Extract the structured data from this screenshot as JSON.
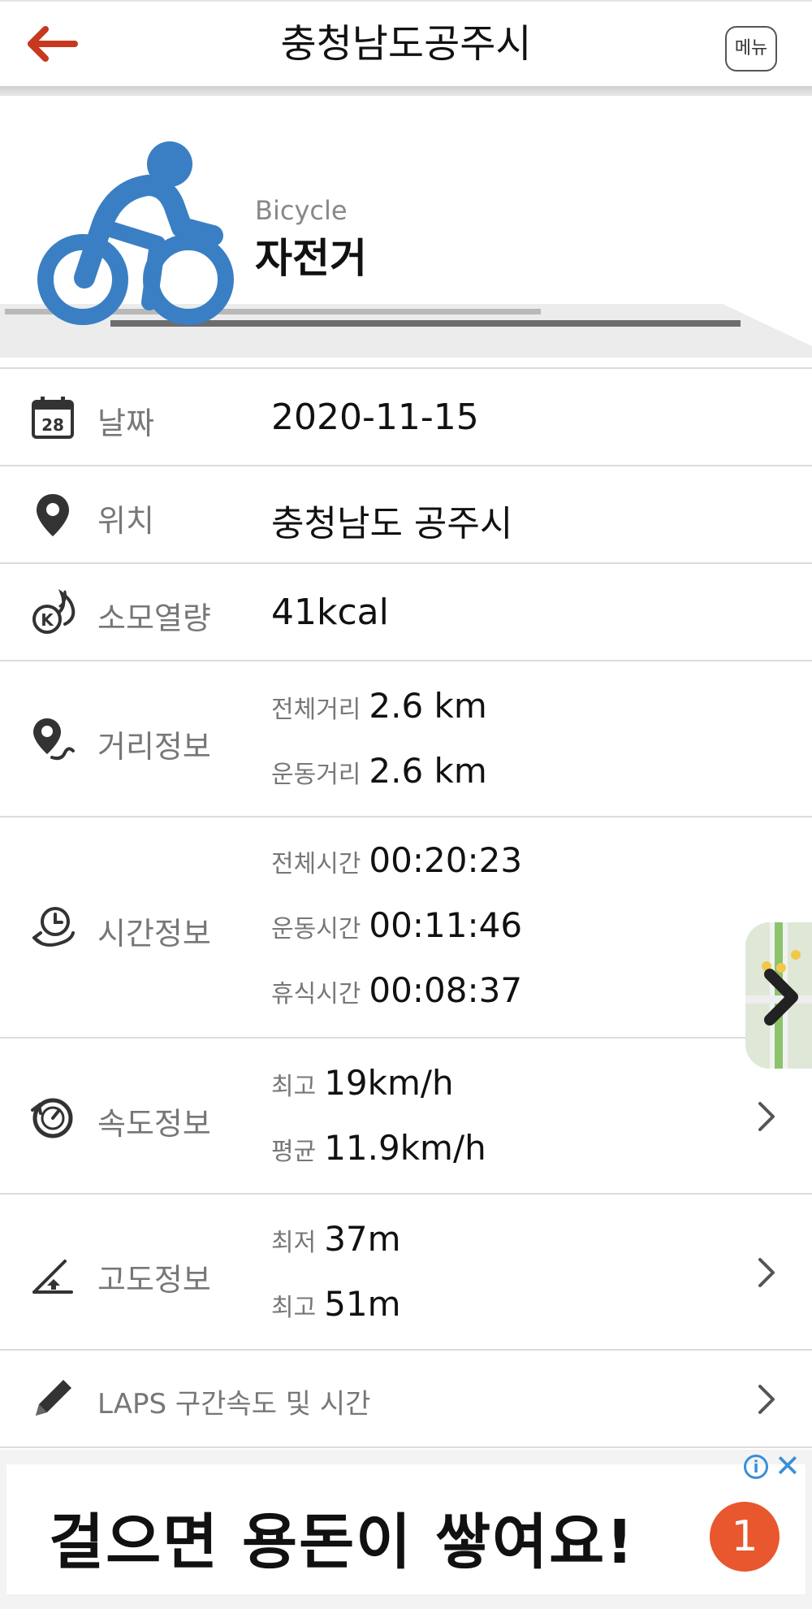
{
  "header": {
    "title": "충청남도공주시",
    "menu_label": "메뉴"
  },
  "hero": {
    "activity_en": "Bicycle",
    "activity_ko": "자전거",
    "accent_color": "#3a7fc3"
  },
  "rows": {
    "date": {
      "label": "날짜",
      "value": "2020-11-15",
      "icon_day": "28"
    },
    "location": {
      "label": "위치",
      "value": "충청남도 공주시"
    },
    "calories": {
      "label": "소모열량",
      "value": "41kcal"
    },
    "distance": {
      "label": "거리정보",
      "items": [
        {
          "key": "전체거리",
          "value": "2.6 km"
        },
        {
          "key": "운동거리",
          "value": "2.6 km"
        }
      ]
    },
    "time": {
      "label": "시간정보",
      "items": [
        {
          "key": "전체시간",
          "value": "00:20:23"
        },
        {
          "key": "운동시간",
          "value": "00:11:46"
        },
        {
          "key": "휴식시간",
          "value": "00:08:37"
        }
      ]
    },
    "speed": {
      "label": "속도정보",
      "items": [
        {
          "key": "최고",
          "value": "19km/h"
        },
        {
          "key": "평균",
          "value": "11.9km/h"
        }
      ]
    },
    "altitude": {
      "label": "고도정보",
      "items": [
        {
          "key": "최저",
          "value": "37m"
        },
        {
          "key": "최고",
          "value": "51m"
        }
      ]
    },
    "laps": {
      "label": "LAPS 구간속도 및 시간"
    }
  },
  "ad": {
    "text": "걸으면 용돈이 쌓여요!",
    "badge": "1",
    "info": "i",
    "close": "✕"
  },
  "icons": {
    "back": "back-arrow-icon",
    "bike": "bicycle-icon",
    "calendar": "calendar-icon",
    "pin": "location-pin-icon",
    "calorie": "calorie-flame-icon",
    "distance": "route-pin-icon",
    "time": "clock-icon",
    "speed": "speedometer-icon",
    "altitude": "altitude-icon",
    "pencil": "pencil-icon",
    "chevron": "chevron-right-icon"
  },
  "colors": {
    "back_arrow": "#c8381f",
    "icon_dark": "#333333",
    "ad_badge": "#e8572e",
    "ad_controls": "#3a8fd8"
  }
}
